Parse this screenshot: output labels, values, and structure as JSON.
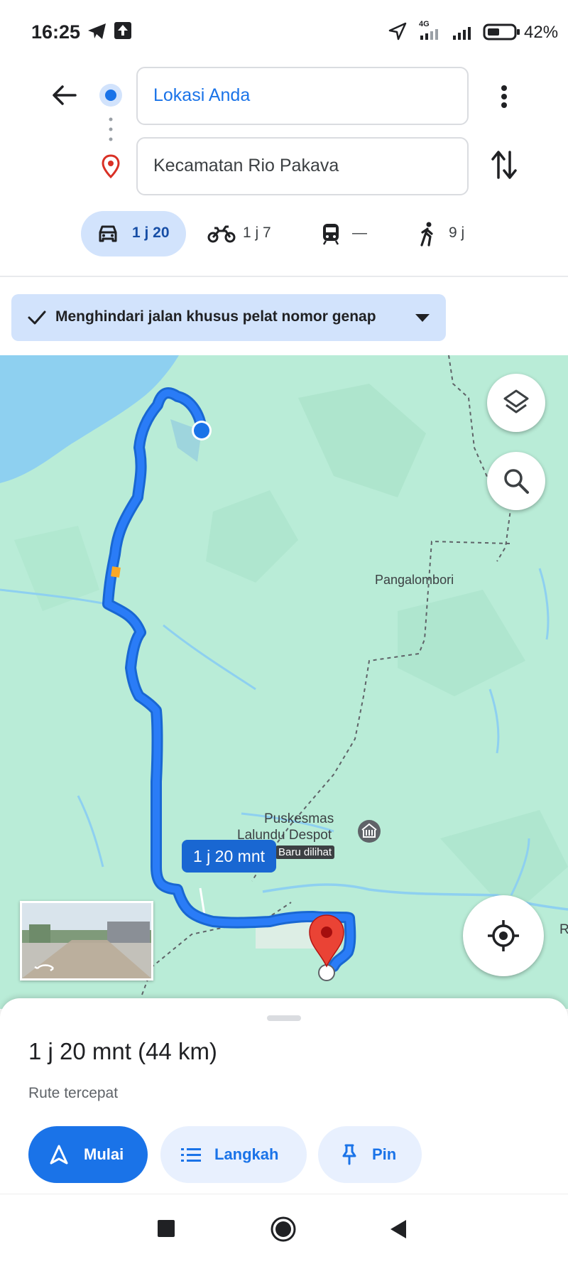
{
  "status": {
    "time": "16:25",
    "network": "4G",
    "battery_percent": "42%"
  },
  "search": {
    "origin": "Lokasi Anda",
    "destination": "Kecamatan Rio Pakava"
  },
  "modes": {
    "car": "1 j 20",
    "motorcycle": "1 j 7",
    "transit": "—",
    "walk": "9 j"
  },
  "filter_chip": "Menghindari jalan khusus pelat nomor genap",
  "map": {
    "labels": {
      "place_1": "Pangalombori",
      "poi_line1": "Puskesmas",
      "poi_line2": "Lalundu Despot",
      "recent_tag": "Baru dilihat",
      "edge_letter": "R"
    },
    "route_badge": "1 j 20 mnt",
    "route_color": "#1967d2",
    "water_color": "#8ed0f0",
    "land_color": "#b9ecd7"
  },
  "sheet": {
    "summary": "1 j 20 mnt (44 km)",
    "subtitle": "Rute tercepat",
    "start_label": "Mulai",
    "steps_label": "Langkah",
    "pin_label": "Pin"
  },
  "icons": [
    "back-arrow-icon",
    "more-vert-icon",
    "swap-icon",
    "car-icon",
    "motorcycle-icon",
    "train-icon",
    "walk-icon",
    "check-icon",
    "dropdown-icon",
    "layers-icon",
    "search-icon",
    "my-location-icon",
    "navigation-icon",
    "list-icon",
    "pin-icon"
  ]
}
